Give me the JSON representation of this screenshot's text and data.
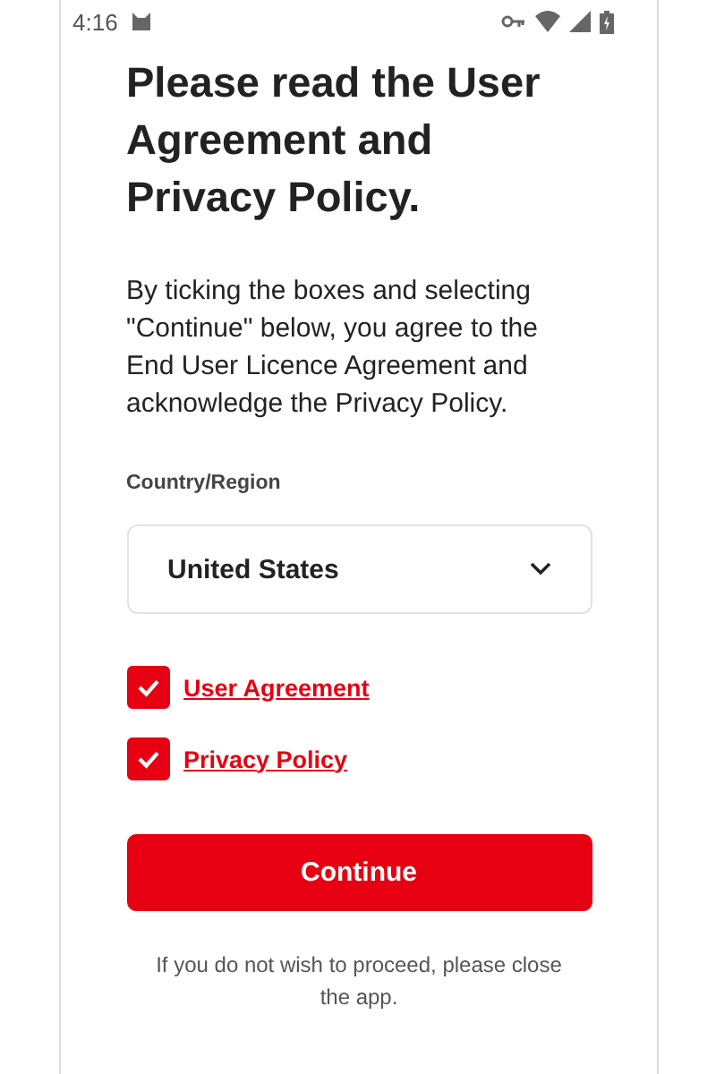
{
  "status_bar": {
    "time": "4:16"
  },
  "title": "Please read the User Agreement and Privacy Policy.",
  "description": "By ticking the boxes and selecting \"Continue\" below, you agree to the End User Licence Agreement and acknowledge the Privacy Policy.",
  "country": {
    "label": "Country/Region",
    "value": "United States"
  },
  "agreements": [
    {
      "label": "User Agreement",
      "checked": true
    },
    {
      "label": "Privacy Policy",
      "checked": true
    }
  ],
  "continue_button": "Continue",
  "footer": "If you do not wish to proceed, please close the app."
}
